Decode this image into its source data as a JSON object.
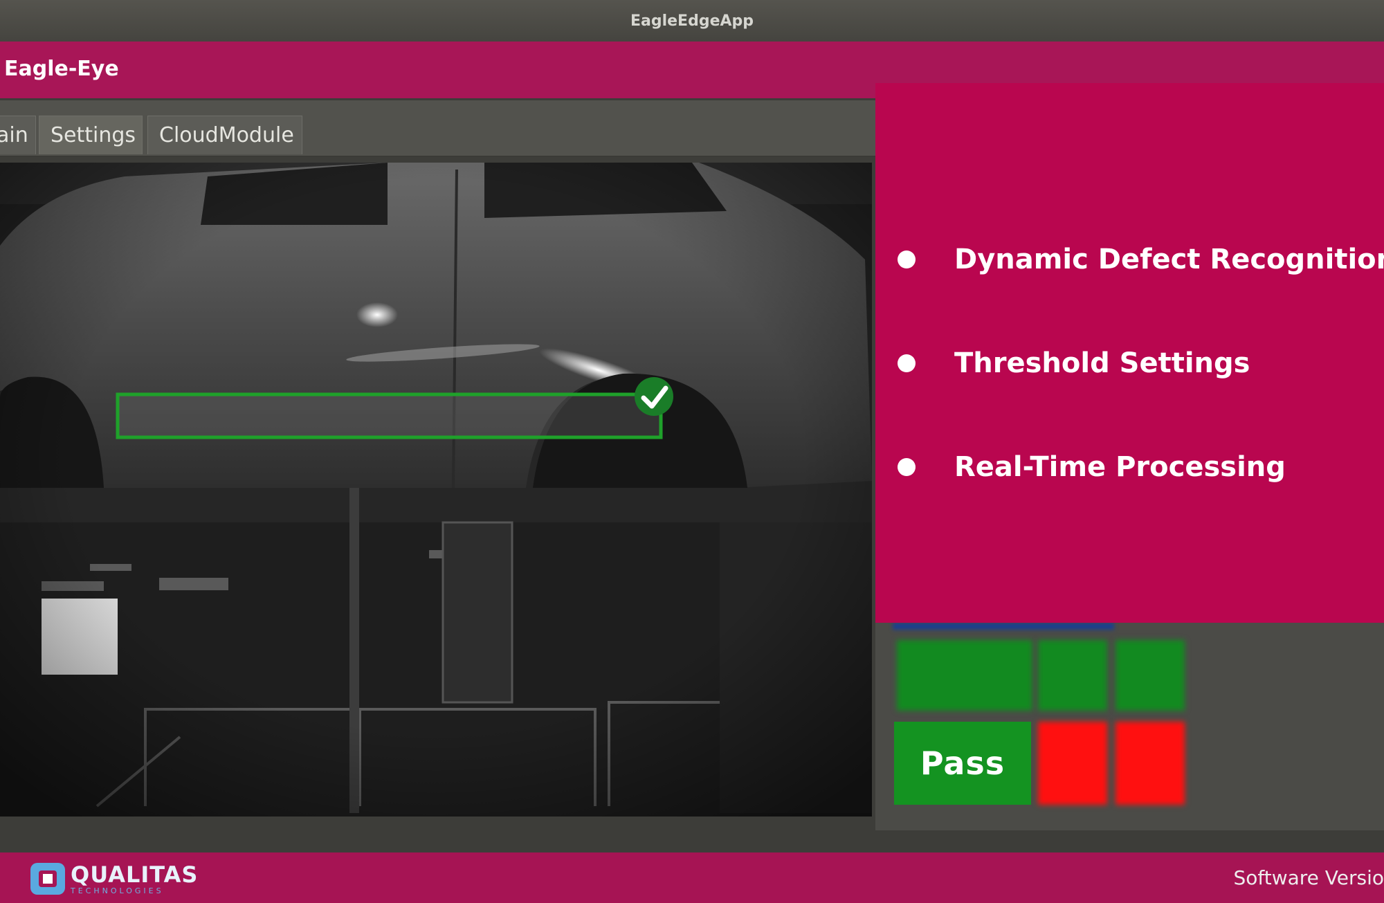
{
  "window": {
    "title": "EagleEdgeApp"
  },
  "app": {
    "name": "Eagle-Eye"
  },
  "tabs": [
    {
      "label": "ain"
    },
    {
      "label": "Settings"
    },
    {
      "label": "CloudModule"
    }
  ],
  "features": [
    {
      "label": "Dynamic Defect Recognition"
    },
    {
      "label": "Threshold Settings"
    },
    {
      "label": "Real-Time Processing"
    }
  ],
  "result": {
    "label": "Pass",
    "color": "#149321"
  },
  "footer": {
    "brand": "QUALITAS",
    "brand_sub": "TECHNOLOGIES",
    "version_label": "Software Versio"
  },
  "colors": {
    "brand": "#a81657",
    "panel": "#b9064f",
    "pass": "#149321",
    "fail": "#ff0000",
    "detection_box": "#1fa12a"
  },
  "icons": {
    "detection_status": "checkmark-icon"
  }
}
